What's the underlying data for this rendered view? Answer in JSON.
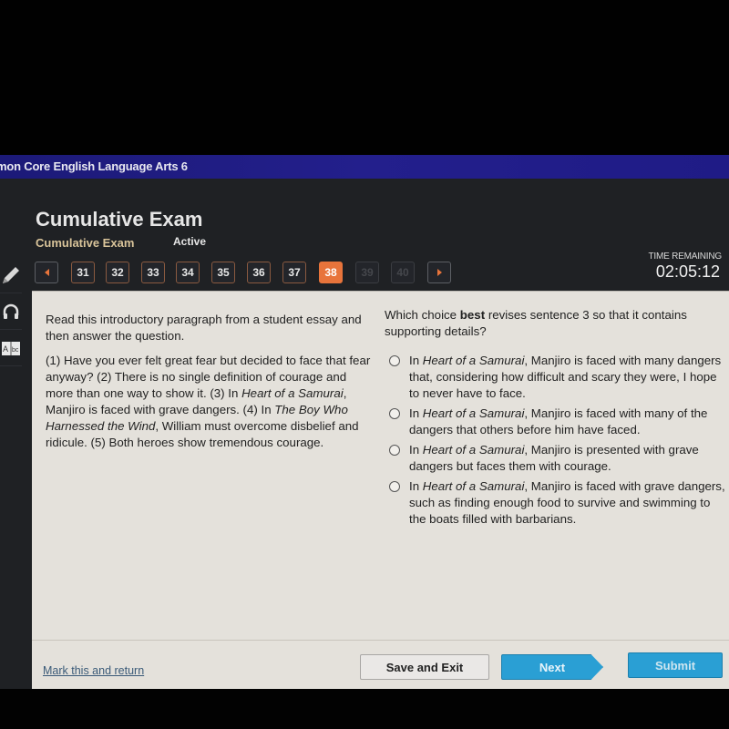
{
  "course": {
    "title": "mon Core English Language Arts 6"
  },
  "exam": {
    "title": "Cumulative Exam",
    "subtitle": "Cumulative Exam",
    "status": "Active"
  },
  "navigation": {
    "prev_icon": "triangle-left-icon",
    "next_icon": "triangle-right-icon",
    "questions": [
      {
        "number": "31",
        "state": "answered"
      },
      {
        "number": "32",
        "state": "answered"
      },
      {
        "number": "33",
        "state": "answered"
      },
      {
        "number": "34",
        "state": "answered"
      },
      {
        "number": "35",
        "state": "answered"
      },
      {
        "number": "36",
        "state": "answered"
      },
      {
        "number": "37",
        "state": "answered"
      },
      {
        "number": "38",
        "state": "current"
      },
      {
        "number": "39",
        "state": "disabled"
      },
      {
        "number": "40",
        "state": "disabled"
      }
    ]
  },
  "timer": {
    "label": "TIME REMAINING",
    "value": "02:05:12"
  },
  "tools": [
    {
      "name": "pencil-icon"
    },
    {
      "name": "headphones-icon"
    },
    {
      "name": "dictionary-icon",
      "label": "A bc"
    }
  ],
  "colors": {
    "accent": "#e8743b",
    "primary_button": "#2a9fd4",
    "course_bar": "#231f8c"
  },
  "passage": {
    "instructions": "Read this introductory paragraph from a student essay and then answer the question.",
    "segments": [
      {
        "text": "(1) Have you ever felt great fear but decided to face that fear anyway? (2) There is no single definition of courage and more than one way to show it. (3) In ",
        "italic": false
      },
      {
        "text": "Heart of a Samurai",
        "italic": true
      },
      {
        "text": ", Manjiro is faced with grave dangers. (4) In ",
        "italic": false
      },
      {
        "text": "The Boy Who Harnessed the Wind",
        "italic": true
      },
      {
        "text": ", William must overcome disbelief and ridicule. (5) Both heroes show tremendous courage.",
        "italic": false
      }
    ]
  },
  "question": {
    "prompt_before": "Which choice ",
    "prompt_bold": "best",
    "prompt_after": " revises sentence 3 so that it contains supporting details?",
    "choices": [
      {
        "prefix": "In ",
        "title": "Heart of a Samurai",
        "rest": ", Manjiro is faced with many dangers that, considering how difficult and scary they were, I hope to never have to face.",
        "selected": false
      },
      {
        "prefix": "In ",
        "title": "Heart of a Samurai",
        "rest": ", Manjiro is faced with many of the dangers that others before him have faced.",
        "selected": false
      },
      {
        "prefix": "In ",
        "title": "Heart of a Samurai",
        "rest": ", Manjiro is presented with grave dangers but faces them with courage.",
        "selected": false
      },
      {
        "prefix": "In ",
        "title": "Heart of a Samurai",
        "rest": ", Manjiro is faced with grave dangers, such as finding enough food to survive and swimming to the boats filled with barbarians.",
        "selected": false
      }
    ]
  },
  "footer": {
    "mark_link": "Mark this and return",
    "save_label": "Save and Exit",
    "next_label": "Next",
    "submit_label": "Submit"
  }
}
